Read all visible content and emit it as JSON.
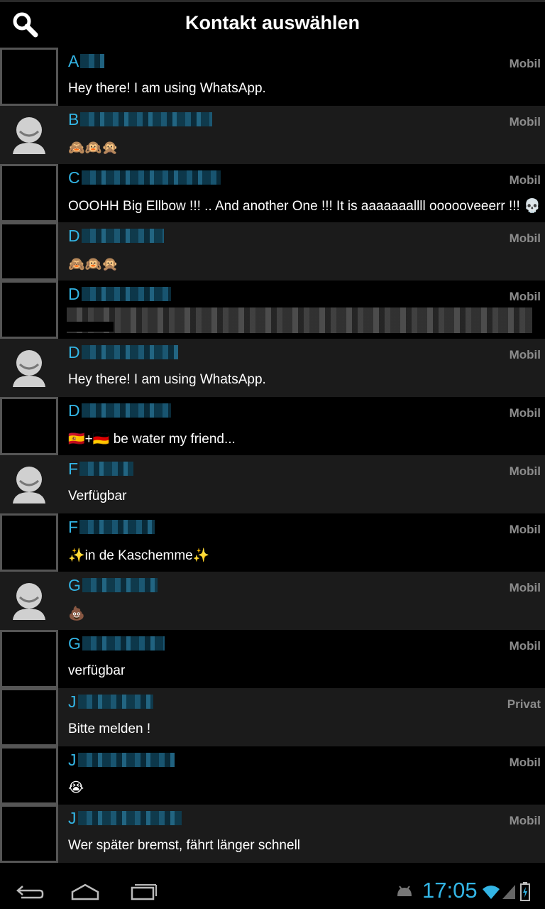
{
  "header": {
    "title": "Kontakt auswählen",
    "search_icon": "search-icon"
  },
  "contacts": [
    {
      "initial": "A",
      "type": "Mobil",
      "status": "Hey there! I am using WhatsApp.",
      "avatar": "photo"
    },
    {
      "initial": "B",
      "type": "Mobil",
      "status": "🙈🙉🙊",
      "avatar": "placeholder"
    },
    {
      "initial": "C",
      "type": "Mobil",
      "status": "OOOHH Big Ellbow !!! .. And another One !!! It is aaaaaaallll oooooveeerr !!! 💀",
      "avatar": "photo"
    },
    {
      "initial": "D",
      "type": "Mobil",
      "status": "🙈🙉🙊",
      "avatar": "photo"
    },
    {
      "initial": "D",
      "type": "Mobil",
      "status": "",
      "avatar": "photo"
    },
    {
      "initial": "D",
      "type": "Mobil",
      "status": "Hey there! I am using WhatsApp.",
      "avatar": "placeholder"
    },
    {
      "initial": "D",
      "type": "Mobil",
      "status": "🇪🇸+🇩🇪  be water my friend...",
      "avatar": "photo"
    },
    {
      "initial": "F",
      "type": "Mobil",
      "status": "Verfügbar",
      "avatar": "placeholder"
    },
    {
      "initial": "F",
      "type": "Mobil",
      "status": "✨in de Kaschemme✨",
      "avatar": "photo"
    },
    {
      "initial": "G",
      "type": "Mobil",
      "status": "💩",
      "avatar": "placeholder"
    },
    {
      "initial": "G",
      "type": "Mobil",
      "status": "verfügbar",
      "avatar": "photo"
    },
    {
      "initial": "J",
      "type": "Privat",
      "status": "Bitte melden !",
      "avatar": "photo"
    },
    {
      "initial": "J",
      "type": "Mobil",
      "status": "😭",
      "avatar": "photo"
    },
    {
      "initial": "J",
      "type": "Mobil",
      "status": "Wer später bremst, fährt länger schnell",
      "avatar": "photo"
    }
  ],
  "system_bar": {
    "time": "17:05",
    "accent_color": "#33b5e5",
    "back_icon": "back-icon",
    "home_icon": "home-icon",
    "recents_icon": "recent-apps-icon",
    "debug_icon": "android-debug-icon",
    "wifi_icon": "wifi-icon",
    "signal_icon": "signal-icon",
    "battery_icon": "battery-charging-icon"
  }
}
